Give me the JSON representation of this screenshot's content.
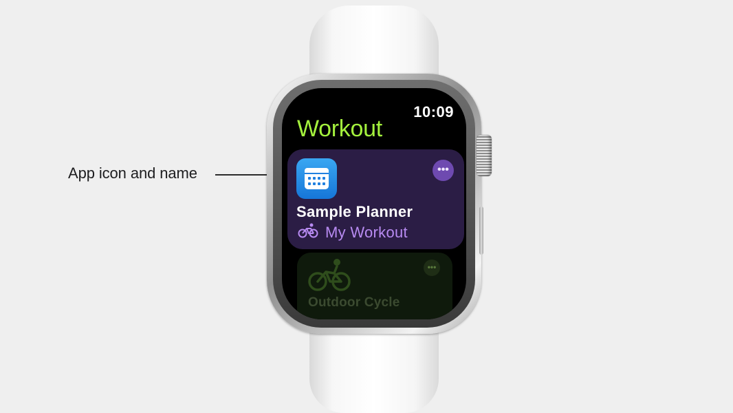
{
  "callout": {
    "label": "App icon and name"
  },
  "watch": {
    "time": "10:09",
    "screen_title": "Workout",
    "title_color": "#a4f13d",
    "primary_card": {
      "app_icon": "calendar-icon",
      "app_name": "Sample Planner",
      "workout_icon": "bicycle-icon",
      "workout_name": "My Workout",
      "more_icon": "ellipsis-icon",
      "accent": "#b88bf2"
    },
    "secondary_card": {
      "icon": "cyclist-icon",
      "name": "Outdoor Cycle",
      "more_icon": "ellipsis-icon"
    }
  }
}
